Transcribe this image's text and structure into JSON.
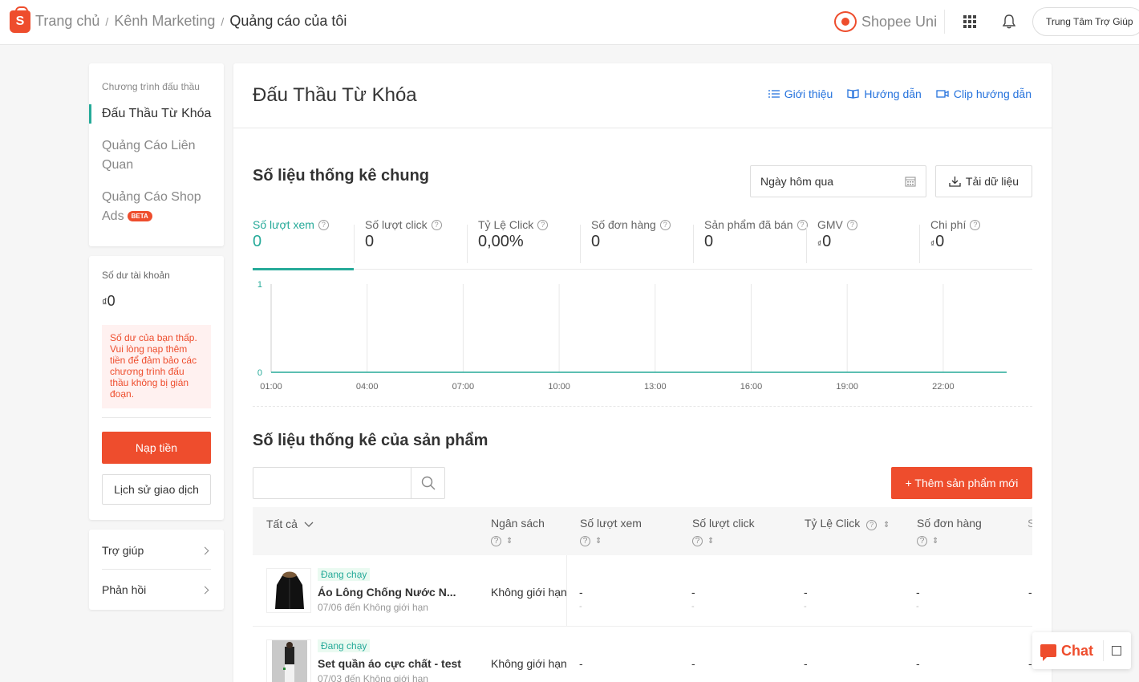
{
  "header": {
    "breadcrumb": [
      "Trang chủ",
      "Kênh Marketing",
      "Quảng cáo của tôi"
    ],
    "shopee_uni": "Shopee Uni",
    "help_center": "Trung Tâm Trợ Giúp"
  },
  "sidebar": {
    "group_title": "Chương trình đấu thầu",
    "items": [
      {
        "label": "Đấu Thầu Từ Khóa",
        "active": true
      },
      {
        "label": "Quảng Cáo Liên Quan"
      },
      {
        "label": "Quảng Cáo Shop Ads",
        "badge": "BETA"
      }
    ],
    "balance_label": "Số dư tài khoản",
    "balance_currency": "₫",
    "balance_value": "0",
    "warning": "Số dư của bạn thấp. Vui lòng nạp thêm tiền để đảm bảo các chương trình đấu thầu không bị gián đoạn.",
    "topup_label": "Nạp tiền",
    "history_label": "Lịch sử giao dịch",
    "help_items": [
      "Trợ giúp",
      "Phản hồi"
    ]
  },
  "main": {
    "title": "Đấu Thầu Từ Khóa",
    "links": [
      "Giới thiệu",
      "Hướng dẫn",
      "Clip hướng dẫn"
    ],
    "stats_title": "Số liệu thống kê chung",
    "date_range": "Ngày hôm qua",
    "download_label": "Tải dữ liệu",
    "metrics": [
      {
        "label": "Số lượt xem",
        "value": "0",
        "active": true
      },
      {
        "label": "Số lượt click",
        "value": "0"
      },
      {
        "label": "Tỷ Lệ Click",
        "value": "0,00%"
      },
      {
        "label": "Số đơn hàng",
        "value": "0"
      },
      {
        "label": "Sản phẩm đã bán",
        "value": "0"
      },
      {
        "label": "GMV",
        "value": "0",
        "currency": "₫"
      },
      {
        "label": "Chi phí",
        "value": "0",
        "currency": "₫"
      }
    ],
    "product_stats_title": "Số liệu thống kê của sản phẩm",
    "search_placeholder": "",
    "add_product_label": "+ Thêm sản phẩm mới",
    "table": {
      "columns": [
        "Tất cả",
        "Ngân sách",
        "Số lượt xem",
        "Số lượt click",
        "Tỷ Lệ Click",
        "Số đơn hàng"
      ],
      "rows": [
        {
          "status": "Đang chạy",
          "name": "Áo Lông Chống Nước N...",
          "dates": "07/06 đến Không giới hạn",
          "budget": "Không giới hạn"
        },
        {
          "status": "Đang chạy",
          "name": "Set quần áo cực chất - test",
          "dates": "07/03 đến Không giới hạn",
          "budget": "Không giới hạn"
        }
      ],
      "empty_value": "-"
    }
  },
  "chat_label": "Chat",
  "chart_data": {
    "type": "line",
    "x": [
      "01:00",
      "04:00",
      "07:00",
      "10:00",
      "13:00",
      "16:00",
      "19:00",
      "22:00"
    ],
    "series": [
      {
        "values": [
          0,
          0,
          0,
          0,
          0,
          0,
          0,
          0
        ]
      }
    ],
    "yticks": [
      "1",
      "0"
    ],
    "ylim": [
      0,
      1
    ],
    "color": "#26aa99"
  },
  "colors": {
    "brand": "#ee4d2d",
    "accent": "#26aa99",
    "link": "#2673dd"
  }
}
